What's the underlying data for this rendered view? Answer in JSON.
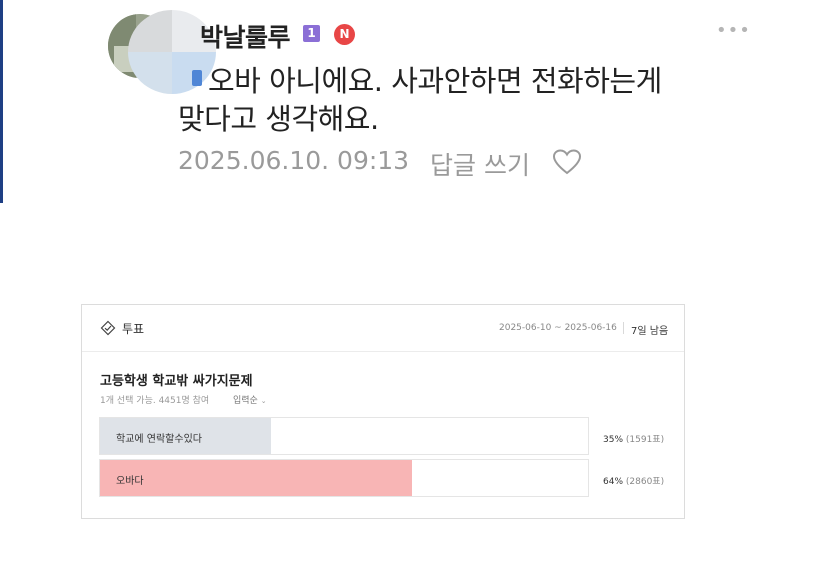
{
  "comment": {
    "author": "박날룰루",
    "level_badge": "1",
    "new_badge": "N",
    "more_icon": "•••",
    "text_line1": "오바 아니에요. 사과안하면 전화하는게",
    "text_line2": "맞다고 생각해요.",
    "date": "2025.06.10. 09:13",
    "reply_label": "답글 쓰기",
    "icons": {
      "more": "more-icon",
      "like": "heart-icon",
      "mention": "mention-icon"
    }
  },
  "vote": {
    "header_label": "투표",
    "period": "2025-06-10 ~ 2025-06-16",
    "remaining": "7일 남음",
    "question": "고등학생 학교밖 싸가지문제",
    "meta": "1개 선택 가능. 4451명 참여",
    "sort_label": "입력순",
    "options": [
      {
        "label": "학교에 연락할수있다",
        "percent_text": "35%",
        "votes_text": "(1591표)",
        "fraction": 0.35,
        "color": "#dfe3e8"
      },
      {
        "label": "오바다",
        "percent_text": "64%",
        "votes_text": "(2860표)",
        "fraction": 0.64,
        "color": "#f8b5b5"
      }
    ]
  },
  "colors": {
    "accent_bar": "#1e3f84",
    "new_badge": "#e84646",
    "level_badge": "#8b6fd6"
  }
}
